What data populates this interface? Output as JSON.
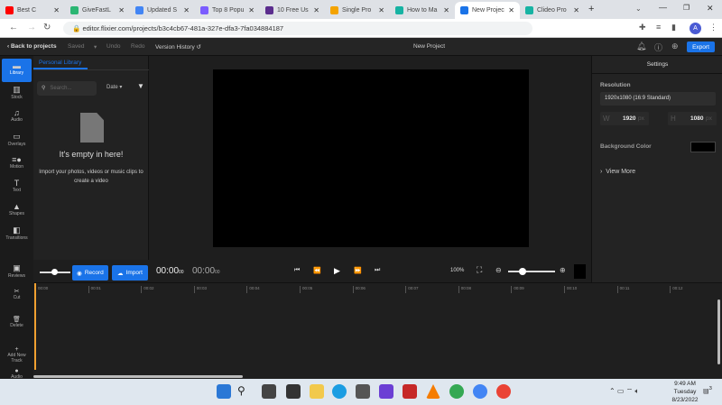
{
  "browser": {
    "tabs": [
      {
        "title": "Best C",
        "color": "#ff0000"
      },
      {
        "title": "GiveFastL",
        "color": "#2bb673"
      },
      {
        "title": "Updated S",
        "color": "#4285f4"
      },
      {
        "title": "Top 8 Popu",
        "color": "#7b5cff"
      },
      {
        "title": "10 Free Us",
        "color": "#5b2d8e"
      },
      {
        "title": "Single Pro",
        "color": "#f4a300"
      },
      {
        "title": "How to Ma",
        "color": "#17b3a3"
      },
      {
        "title": "New Projec",
        "color": "#1a73e8",
        "active": true
      },
      {
        "title": "Clideo Pro",
        "color": "#17b3a3"
      }
    ],
    "url": "editor.flixier.com/projects/b3c4cb67-481a-327e-dfa3-7fa034884187",
    "profile_initial": "A"
  },
  "header": {
    "back": "Back to projects",
    "saved": "Saved",
    "undo": "Undo",
    "redo": "Redo",
    "version_history": "Version History",
    "title": "New Project",
    "export": "Export"
  },
  "rail": [
    {
      "label": "Library",
      "icon": "folder-icon",
      "glyph": "▬"
    },
    {
      "label": "Stock",
      "icon": "stock-icon",
      "glyph": "▥"
    },
    {
      "label": "Audio",
      "icon": "music-icon",
      "glyph": "♫"
    },
    {
      "label": "Overlays",
      "icon": "overlay-icon",
      "glyph": "▭"
    },
    {
      "label": "Motion",
      "icon": "motion-icon",
      "glyph": "≡●"
    },
    {
      "label": "Text",
      "icon": "text-icon",
      "glyph": "T"
    },
    {
      "label": "Shapes",
      "icon": "shapes-icon",
      "glyph": "▲"
    },
    {
      "label": "Transitions",
      "icon": "transitions-icon",
      "glyph": "◧"
    },
    {
      "label": "Reviews",
      "icon": "reviews-icon",
      "glyph": "▣"
    }
  ],
  "timeline_tools": [
    {
      "label": "Cut",
      "glyph": "✂"
    },
    {
      "label": "Delete",
      "glyph": "🗑"
    },
    {
      "label": "Add New Track",
      "glyph": "+"
    },
    {
      "label": "Audio",
      "glyph": "●"
    }
  ],
  "library": {
    "tab": "Personal Library",
    "search_placeholder": "Search...",
    "sort": "Date",
    "empty_title": "It's empty in here!",
    "empty_text": "Import your photos, videos or music clips to create a video",
    "record": "Record",
    "import": "Import"
  },
  "player": {
    "current_time": "00:00",
    "current_frames": "00",
    "total_time": "00:00",
    "total_frames": "00",
    "zoom": "100%",
    "slider_level": 0.3
  },
  "settings": {
    "title": "Settings",
    "resolution_label": "Resolution",
    "resolution": "1920x1080 (16:9 Standard)",
    "w_label": "W",
    "width": "1920",
    "h_label": "H",
    "height": "1080",
    "unit": "px",
    "bg_label": "Background Color",
    "bg_color": "#000000",
    "view_more": "View More"
  },
  "ruler": [
    "00:00",
    "00:01",
    "00:02",
    "00:03",
    "00:04",
    "00:05",
    "00:06",
    "00:07",
    "00:08",
    "00:09",
    "00:10",
    "00:11",
    "00:12"
  ],
  "taskbar": {
    "time": "9:49 AM",
    "day": "Tuesday",
    "date": "8/23/2022",
    "notifications": "3"
  }
}
